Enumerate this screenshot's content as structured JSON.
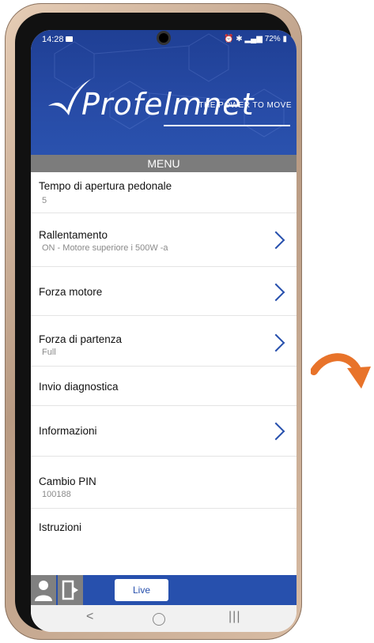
{
  "status_bar": {
    "time": "14:28",
    "battery": "72%"
  },
  "header": {
    "logo_text": "Profelmnet",
    "tagline": "THE POWER TO MOVE"
  },
  "menu_title": "MENU",
  "menu_items": [
    {
      "label": "Tempo di apertura pedonale",
      "value": "5",
      "has_arrow": false
    },
    {
      "label": "Rallentamento",
      "value": "ON - Motore superiore i 500W -a",
      "has_arrow": true
    },
    {
      "label": "Forza motore",
      "value": "",
      "has_arrow": true
    },
    {
      "label": "Forza di partenza",
      "value": "Full",
      "has_arrow": true
    },
    {
      "label": "Invio diagnostica",
      "value": "",
      "has_arrow": false
    },
    {
      "label": "Informazioni",
      "value": "",
      "has_arrow": true
    },
    {
      "label": "Cambio PIN",
      "value": "100188",
      "has_arrow": false
    },
    {
      "label": "Istruzioni",
      "value": "",
      "has_arrow": false
    }
  ],
  "bottom_bar": {
    "live_label": "Live"
  },
  "nav": {
    "back": "<",
    "recent": "|||"
  },
  "colors": {
    "brand_blue": "#2750ad",
    "menu_gray": "#7c7c7c",
    "arrow_orange": "#e8732a"
  },
  "icons": [
    "user-icon",
    "exit-icon",
    "chevron-right-icon",
    "curved-arrow-icon"
  ]
}
